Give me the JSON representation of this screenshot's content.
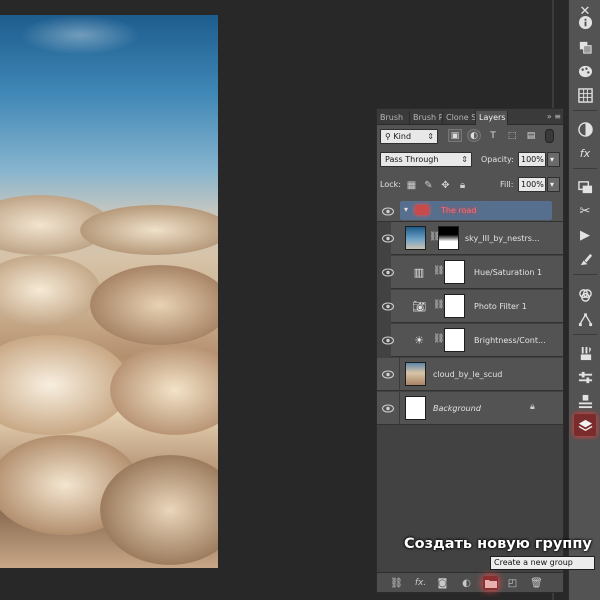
{
  "panel": {
    "tabs": [
      "Brush",
      "Brush P",
      "Clone S",
      "Layers"
    ],
    "active_tab": "Layers",
    "tab_menu": "»"
  },
  "filter": {
    "kind_label": "Kind"
  },
  "blend": {
    "mode": "Pass Through",
    "opacity_label": "Opacity:",
    "opacity_value": "100%"
  },
  "lock": {
    "label": "Lock:",
    "fill_label": "Fill:",
    "fill_value": "100%"
  },
  "layers": [
    {
      "name": "The road",
      "type": "group"
    },
    {
      "name": "sky_III_by_nestrs...",
      "type": "image-with-mask"
    },
    {
      "name": "Hue/Saturation 1",
      "type": "adjustment"
    },
    {
      "name": "Photo Filter 1",
      "type": "adjustment"
    },
    {
      "name": "Brightness/Cont...",
      "type": "adjustment"
    },
    {
      "name": "cloud_by_le_scud",
      "type": "image"
    },
    {
      "name": "Background",
      "type": "background"
    }
  ],
  "caption": "Создать новую группу",
  "tooltip": "Create a new group",
  "colors": {
    "group_accent": "#ff5050",
    "highlight_red": "#ff3b3b",
    "selection_blue": "#566f8e"
  }
}
